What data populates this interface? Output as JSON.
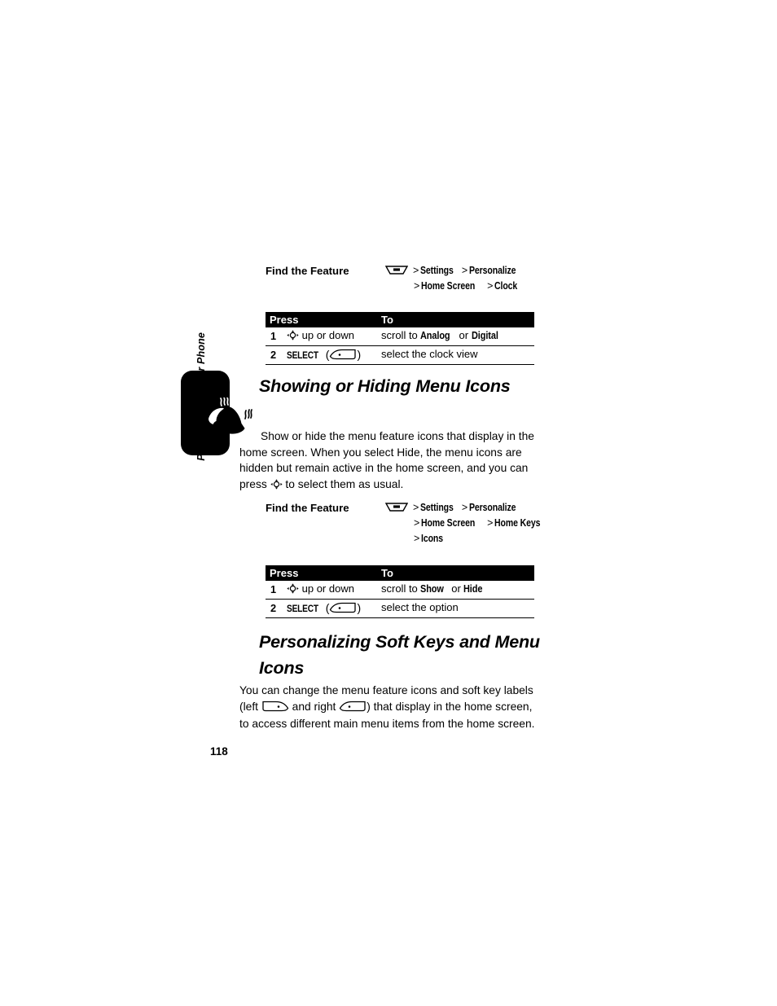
{
  "page": {
    "number": "118",
    "running_head": "Personalizing Your Phone",
    "side_tab_icon": "ringing-bell-icon"
  },
  "sections": [
    {
      "find_the_feature": {
        "label": "Find the Feature",
        "key_icon": "menu-key-icon",
        "lines": [
          [
            {
              "type": "sep",
              "text": ">"
            },
            {
              "type": "term",
              "text": "Settings"
            },
            {
              "type": "sep",
              "text": ">"
            },
            {
              "type": "term",
              "text": "Personalize"
            }
          ],
          [
            {
              "type": "sep",
              "text": ">"
            },
            {
              "type": "term",
              "text": "Home Screen"
            },
            {
              "type": "sep",
              "text": ">"
            },
            {
              "type": "term",
              "text": "Clock"
            }
          ]
        ]
      },
      "table": {
        "headers": [
          "Press",
          "To"
        ],
        "rows": [
          {
            "num": "1",
            "press_icon": "navigation-key-icon",
            "press_text": "up or down",
            "to_prefix": "scroll to ",
            "to_terms": [
              "Analog",
              "Digital"
            ],
            "to_joiner": " or ",
            "to_suffix": ""
          },
          {
            "num": "2",
            "press_label": "SELECT",
            "press_icon": "right-soft-key-icon",
            "to_text": "select the clock view"
          }
        ]
      }
    }
  ],
  "heading_1": "Showing or Hiding Menu Icons",
  "paragraph_1": "Show or hide the menu feature icons that display in the home screen. When you select Hide, the menu icons are hidden but remain active in the home screen, and you can press   to select them as usual.",
  "paragraph_1_parts": {
    "a": "Show or hide the menu feature icons that display in the home screen. When you select Hide, the menu icons are hidden but remain active in the home screen, and you can press ",
    "key": "navigation-key-icon",
    "b": " to select them as usual."
  },
  "find_the_feature_2": {
    "label": "Find the Feature",
    "key_icon": "menu-key-icon",
    "lines": [
      [
        {
          "type": "sep",
          "text": ">"
        },
        {
          "type": "term",
          "text": "Settings"
        },
        {
          "type": "sep",
          "text": ">"
        },
        {
          "type": "term",
          "text": "Personalize"
        }
      ],
      [
        {
          "type": "sep",
          "text": ">"
        },
        {
          "type": "term",
          "text": "Home Screen"
        },
        {
          "type": "sep",
          "text": ">"
        },
        {
          "type": "term",
          "text": "Home Keys"
        }
      ],
      [
        {
          "type": "sep",
          "text": ">"
        },
        {
          "type": "term",
          "text": "Icons"
        }
      ]
    ]
  },
  "table_2": {
    "headers": [
      "Press",
      "To"
    ],
    "rows": [
      {
        "num": "1",
        "press_icon": "navigation-key-icon",
        "press_text": "up or down",
        "to_prefix": "scroll to ",
        "to_terms": [
          "Show",
          "Hide"
        ],
        "to_joiner": " or "
      },
      {
        "num": "2",
        "press_label": "SELECT",
        "press_icon": "right-soft-key-icon",
        "to_text": "select the option"
      }
    ]
  },
  "heading_2": "Personalizing Soft Keys and Menu Icons",
  "paragraph_2_parts": {
    "a": "You can change the menu feature icons and soft key labels (left ",
    "key_left": "left-soft-key-icon",
    "b": " and right ",
    "key_right": "right-soft-key-icon",
    "c": ") that display in the home screen, to access different main menu items from the home screen."
  },
  "labels": {
    "ftf_1_label": "Find the Feature",
    "ftf_2_label": "Find the Feature",
    "t1_h1": "Press",
    "t1_h2": "To",
    "t1_r1_num": "1",
    "t1_r1_press": "up or down",
    "t1_r1_to_pre": "scroll to ",
    "t1_r1_to_t1": "Analog",
    "t1_r1_to_mid": " or ",
    "t1_r1_to_t2": "Digital",
    "t1_r2_num": "2",
    "t1_r2_press": "SELECT",
    "t1_r2_to": "select the clock view",
    "t2_h1": "Press",
    "t2_h2": "To",
    "t2_r1_num": "1",
    "t2_r1_press": "up or down",
    "t2_r1_to_pre": "scroll to ",
    "t2_r1_to_t1": "Show",
    "t2_r1_to_mid": " or ",
    "t2_r1_to_t2": "Hide",
    "t2_r2_num": "2",
    "t2_r2_press": "SELECT",
    "t2_r2_to": "select the option"
  },
  "path_terms": {
    "p1_l1_s1": ">",
    "p1_l1_settings": "Settings",
    "p1_l1_s2": ">",
    "p1_l1_personalize": "Personalize",
    "p1_l2_s1": ">",
    "p1_l2_home": "Home Screen",
    "p1_l2_s2": ">",
    "p1_l2_clock": "Clock",
    "p2_l1_s1": ">",
    "p2_l1_settings": "Settings",
    "p2_l1_s2": ">",
    "p2_l1_personalize": "Personalize",
    "p2_l2_s1": ">",
    "p2_l2_home": "Home Screen",
    "p2_l2_s2": ">",
    "p2_l2_homekeys": "Home Keys",
    "p2_l3_s1": ">",
    "p2_l3_icons": "Icons"
  },
  "colors": {
    "text": "#000000",
    "background": "#ffffff",
    "table_header_bg": "#000000",
    "table_header_text": "#ffffff"
  }
}
